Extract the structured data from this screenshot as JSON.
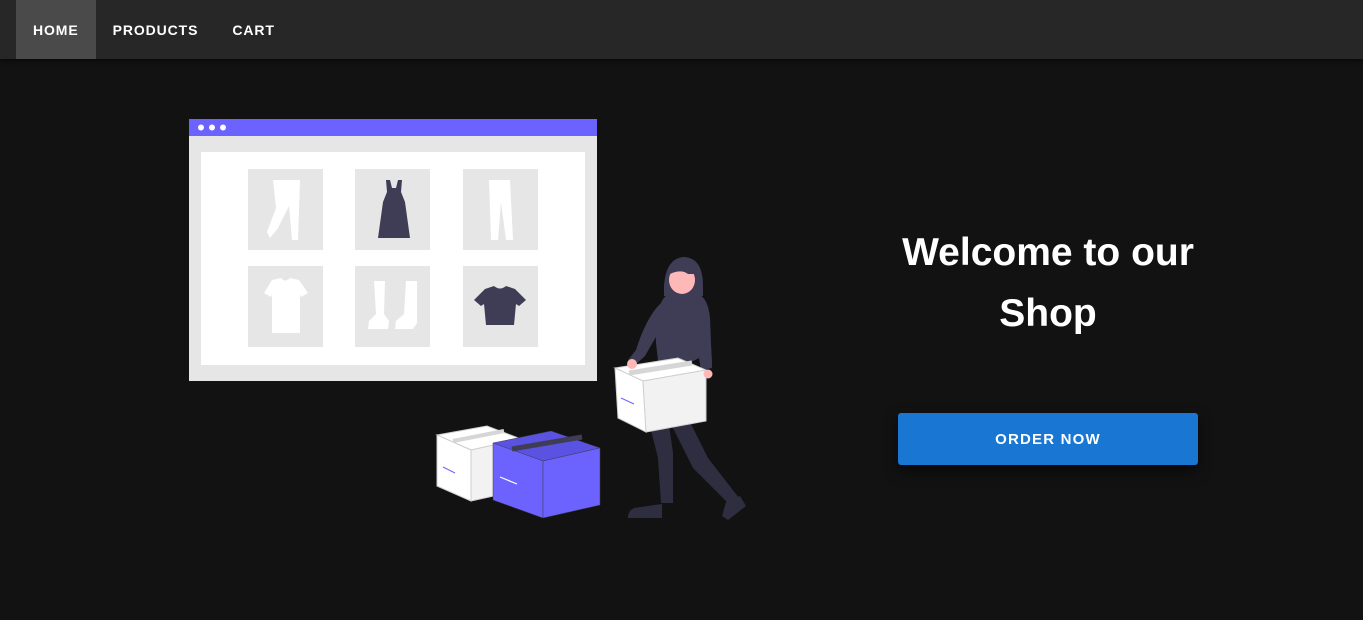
{
  "nav": {
    "items": [
      {
        "label": "HOME",
        "active": true
      },
      {
        "label": "PRODUCTS",
        "active": false
      },
      {
        "label": "CART",
        "active": false
      }
    ]
  },
  "hero": {
    "headline": "Welcome to our Shop",
    "cta_label": "ORDER NOW",
    "illustration": "online-shopping-illustration"
  },
  "colors": {
    "background": "#121212",
    "navbar": "#272727",
    "nav_active": "#4a4a4a",
    "button": "#1976d2",
    "accent": "#6c63ff",
    "figure": "#3f3d56"
  }
}
